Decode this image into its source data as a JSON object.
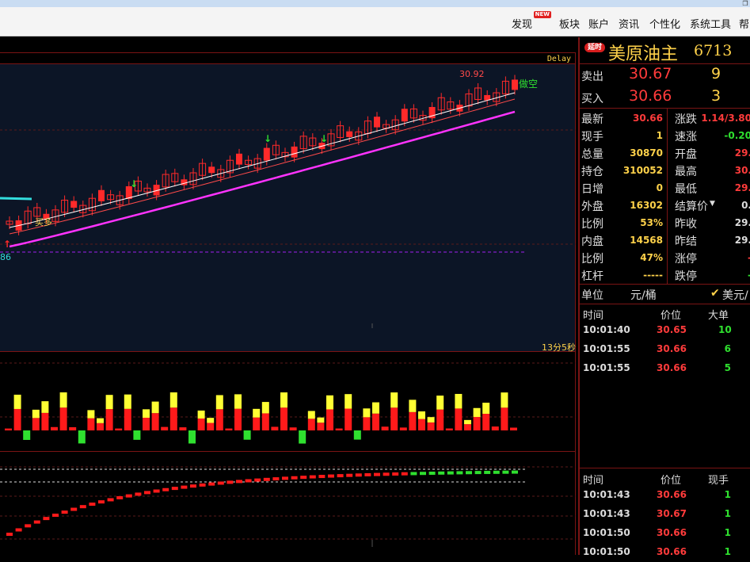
{
  "menu": {
    "items": [
      {
        "label": "发现",
        "badge": "NEW"
      },
      {
        "label": "板块"
      },
      {
        "label": "账户"
      },
      {
        "label": "资讯"
      },
      {
        "label": "个性化"
      },
      {
        "label": "系统工具"
      },
      {
        "label": "帮"
      }
    ]
  },
  "chart": {
    "delay_label": "Delay",
    "high_label": "30.92",
    "low_label_partial": "86",
    "signal_sell_label": "做空",
    "signal_buy_label": "买多",
    "time_left": "13分5秒"
  },
  "quote": {
    "delay_badge": "延时",
    "name": "美原油主",
    "code": "6713",
    "sell": {
      "label": "卖出",
      "price": "30.67",
      "volume": "9"
    },
    "buy": {
      "label": "买入",
      "price": "30.66",
      "volume": "3"
    },
    "stats_left": [
      {
        "label": "最新",
        "value": "30.66",
        "color": "#ff3b3b"
      },
      {
        "label": "现手",
        "value": "1",
        "color": "#ffd24a"
      },
      {
        "label": "总量",
        "value": "30870",
        "color": "#ffd24a"
      },
      {
        "label": "持仓",
        "value": "310052",
        "color": "#ffd24a"
      },
      {
        "label": "日增",
        "value": "0",
        "color": "#ffd24a"
      },
      {
        "label": "外盘",
        "value": "16302",
        "color": "#ffd24a"
      },
      {
        "label": "比例",
        "value": "53%",
        "color": "#ffd24a"
      },
      {
        "label": "内盘",
        "value": "14568",
        "color": "#ffd24a"
      },
      {
        "label": "比例",
        "value": "47%",
        "color": "#ffd24a"
      },
      {
        "label": "杠杆",
        "value": "-----",
        "color": "#ffd24a"
      }
    ],
    "stats_right": [
      {
        "label": "涨跌",
        "value": "1.14/3.80",
        "color": "#ff3b3b"
      },
      {
        "label": "速涨",
        "value": "-0.20",
        "color": "#2fe02f"
      },
      {
        "label": "开盘",
        "value": "29.",
        "color": "#ff3b3b"
      },
      {
        "label": "最高",
        "value": "30.",
        "color": "#ff3b3b"
      },
      {
        "label": "最低",
        "value": "29.",
        "color": "#ff3b3b"
      },
      {
        "label": "结算价",
        "value": "0.",
        "color": "#ddd"
      },
      {
        "label": "昨收",
        "value": "29.",
        "color": "#ddd"
      },
      {
        "label": "昨结",
        "value": "29.",
        "color": "#ddd"
      },
      {
        "label": "涨停",
        "value": "-",
        "color": "#ff3b3b"
      },
      {
        "label": "跌停",
        "value": "-",
        "color": "#2fe02f"
      }
    ],
    "unit": {
      "label": "单位",
      "value": "元/桶",
      "alt": "美元/"
    },
    "big_trades": {
      "headers": {
        "time": "时间",
        "price": "价位",
        "vol": "大单"
      },
      "rows": [
        {
          "time": "10:01:40",
          "price": "30.65",
          "vol": "10"
        },
        {
          "time": "10:01:55",
          "price": "30.66",
          "vol": "6"
        },
        {
          "time": "10:01:55",
          "price": "30.66",
          "vol": "5"
        }
      ]
    },
    "ticks": {
      "headers": {
        "time": "时间",
        "price": "价位",
        "vol": "现手"
      },
      "rows": [
        {
          "time": "10:01:43",
          "price": "30.66",
          "vol": "1"
        },
        {
          "time": "10:01:43",
          "price": "30.67",
          "vol": "1"
        },
        {
          "time": "10:01:50",
          "price": "30.66",
          "vol": "1"
        },
        {
          "time": "10:01:50",
          "price": "30.66",
          "vol": "1"
        }
      ]
    }
  }
}
